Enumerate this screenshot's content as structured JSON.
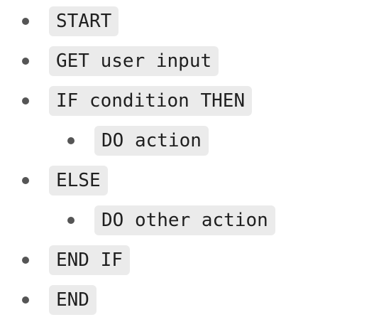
{
  "items": [
    {
      "level": 0,
      "text": "START"
    },
    {
      "level": 0,
      "text": "GET user input"
    },
    {
      "level": 0,
      "text": "IF condition THEN"
    },
    {
      "level": 1,
      "text": "DO action"
    },
    {
      "level": 0,
      "text": "ELSE"
    },
    {
      "level": 1,
      "text": "DO other action"
    },
    {
      "level": 0,
      "text": "END IF"
    },
    {
      "level": 0,
      "text": "END"
    }
  ]
}
